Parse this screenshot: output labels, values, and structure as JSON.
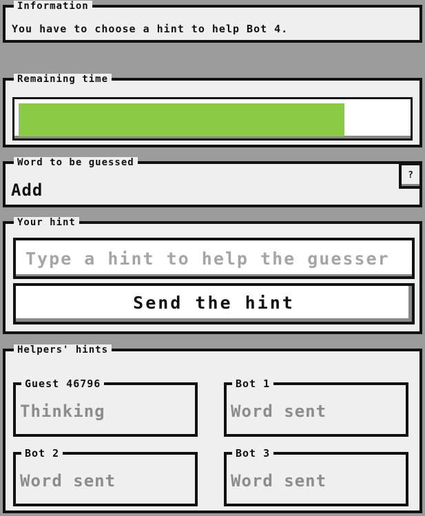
{
  "information": {
    "title": "Information",
    "message": "You have to choose a hint to help Bot 4."
  },
  "remaining_time": {
    "title": "Remaining time",
    "progress_fraction": 0.84,
    "bar_color": "#8cca45"
  },
  "word": {
    "title": "Word to be guessed",
    "value": "Add",
    "help_button_label": "?"
  },
  "your_hint": {
    "title": "Your hint",
    "input_value": "",
    "input_placeholder": "Type a hint to help the guesser",
    "send_button_label": "Send the hint"
  },
  "helpers": {
    "title": "Helpers' hints",
    "items": [
      {
        "name": "Guest 46796",
        "status": "Thinking"
      },
      {
        "name": "Bot 1",
        "status": "Word sent"
      },
      {
        "name": "Bot 2",
        "status": "Word sent"
      },
      {
        "name": "Bot 3",
        "status": "Word sent"
      }
    ]
  }
}
